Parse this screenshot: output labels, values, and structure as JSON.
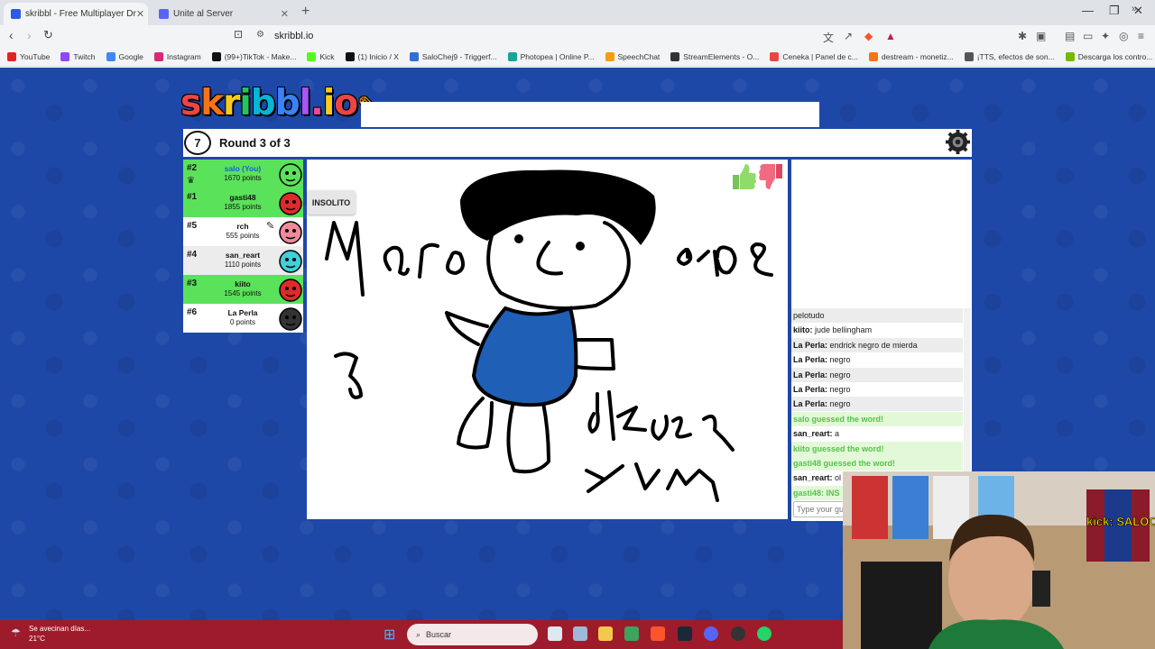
{
  "browser": {
    "tabs": [
      {
        "title": "skribbl - Free Multiplayer Dr",
        "active": true
      },
      {
        "title": "Unite al Server",
        "active": false
      }
    ],
    "url": "skribbl.io",
    "bookmarks": [
      {
        "label": "YouTube",
        "color": "#e02424"
      },
      {
        "label": "Twitch",
        "color": "#9146ff"
      },
      {
        "label": "Google",
        "color": "#4285f4"
      },
      {
        "label": "Instagram",
        "color": "#d62976"
      },
      {
        "label": "(99+)TikTok - Make...",
        "color": "#111111"
      },
      {
        "label": "Kick",
        "color": "#53fc18"
      },
      {
        "label": "(1) Inicio / X",
        "color": "#111111"
      },
      {
        "label": "SaloChej9 - Triggerf...",
        "color": "#2f6fd6"
      },
      {
        "label": "Photopea | Online P...",
        "color": "#18a497"
      },
      {
        "label": "SpeechChat",
        "color": "#f59e0b"
      },
      {
        "label": "StreamElements - O...",
        "color": "#333333"
      },
      {
        "label": "Ceneka | Panel de c...",
        "color": "#ef4444"
      },
      {
        "label": "destream - monetiz...",
        "color": "#f97316"
      },
      {
        "label": "¡TTS, efectos de son...",
        "color": "#555555"
      },
      {
        "label": "Descarga los contro...",
        "color": "#76b900"
      }
    ]
  },
  "game": {
    "timer": "7",
    "round": "Round 3 of 3",
    "word_hint": "INSOLITO",
    "players": [
      {
        "rank": "#2",
        "name": "salo (You)",
        "points": "1670 points",
        "style": "guessed",
        "you": true,
        "avatar": "#5ae25a"
      },
      {
        "rank": "#1",
        "name": "gasti48",
        "points": "1855 points",
        "style": "guessed",
        "you": false,
        "avatar": "#e02a2a"
      },
      {
        "rank": "#5",
        "name": "rch",
        "points": "555 points",
        "style": "normal",
        "you": false,
        "avatar": "#f08a9a"
      },
      {
        "rank": "#4",
        "name": "san_reart",
        "points": "1110 points",
        "style": "alt",
        "you": false,
        "avatar": "#3fd0d8"
      },
      {
        "rank": "#3",
        "name": "kiito",
        "points": "1545 points",
        "style": "guessed",
        "you": false,
        "avatar": "#e02a2a"
      },
      {
        "rank": "#6",
        "name": "La Perla",
        "points": "0 points",
        "style": "normal",
        "you": false,
        "avatar": "#333333"
      }
    ],
    "chat": [
      {
        "who": "",
        "text": "pelotudo",
        "type": "alt"
      },
      {
        "who": "kiito:",
        "text": "jude bellingham",
        "type": "plain"
      },
      {
        "who": "La Perla:",
        "text": "endrick negro de mierda",
        "type": "alt"
      },
      {
        "who": "La Perla:",
        "text": "negro",
        "type": "plain"
      },
      {
        "who": "La Perla:",
        "text": "negro",
        "type": "alt"
      },
      {
        "who": "La Perla:",
        "text": "negro",
        "type": "plain"
      },
      {
        "who": "La Perla:",
        "text": "negro",
        "type": "alt"
      },
      {
        "who": "",
        "text": "salo guessed the word!",
        "type": "guess"
      },
      {
        "who": "san_reart:",
        "text": "a",
        "type": "plain"
      },
      {
        "who": "",
        "text": "kiito guessed the word!",
        "type": "guess"
      },
      {
        "who": "",
        "text": "gasti48 guessed the word!",
        "type": "guess"
      },
      {
        "who": "san_reart:",
        "text": "ol",
        "type": "plain"
      },
      {
        "who": "",
        "text": "gasti48: INS",
        "type": "guess"
      }
    ],
    "chat_placeholder": "Type your gu"
  },
  "stream": {
    "overlay_text": "kick: SALOCHEJ"
  },
  "taskbar": {
    "weather_title": "Se avecinan días...",
    "weather_temp": "21°C",
    "search": "Buscar"
  }
}
